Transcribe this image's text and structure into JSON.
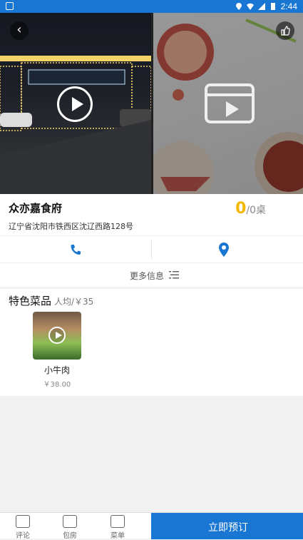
{
  "status_bar": {
    "time": "2:44"
  },
  "restaurant": {
    "name": "众亦嘉食府",
    "address": "辽宁省沈阳市铁西区沈辽西路128号",
    "tables_available": "0",
    "tables_total": "/0桌"
  },
  "more_info": {
    "label": "更多信息"
  },
  "featured": {
    "title": "特色菜品",
    "avg_price": "人均/￥35",
    "dishes": [
      {
        "name": "小牛肉",
        "price": "￥38.00"
      }
    ]
  },
  "bottom_nav": {
    "tabs": [
      {
        "label": "评论",
        "icon": "chat-icon"
      },
      {
        "label": "包房",
        "icon": "door-icon"
      },
      {
        "label": "菜单",
        "icon": "menu-list-icon"
      }
    ],
    "cta_label": "立即预订"
  },
  "colors": {
    "primary": "#1976d2",
    "accent": "#f5b800"
  }
}
